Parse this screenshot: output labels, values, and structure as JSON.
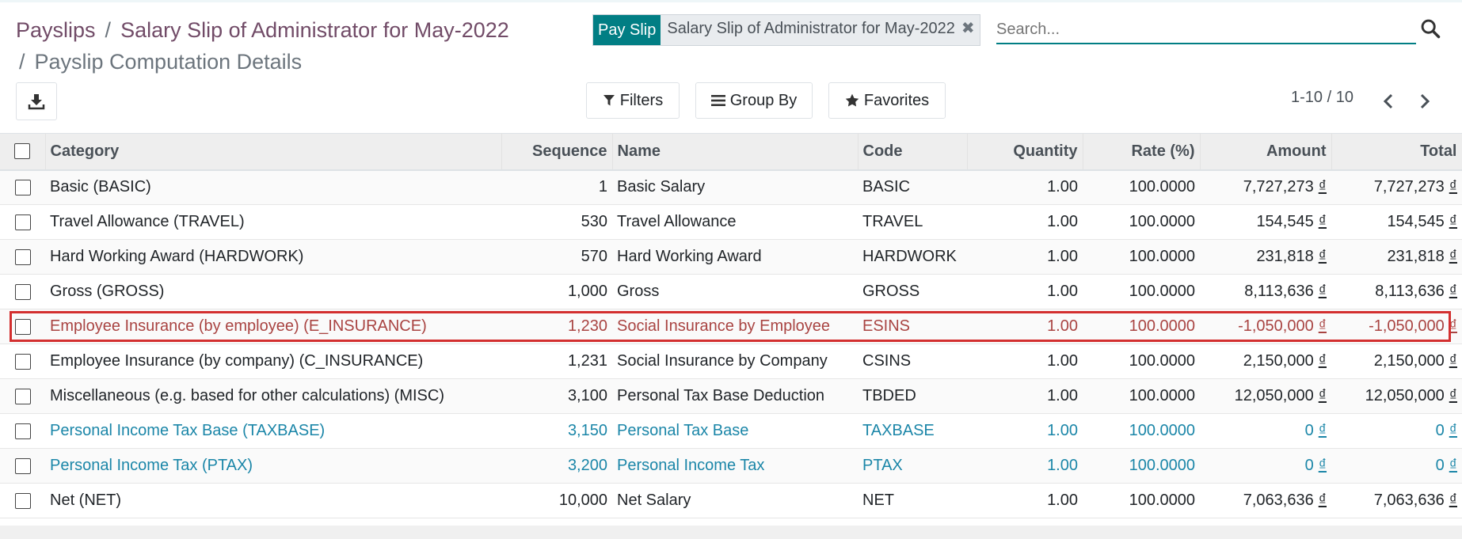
{
  "breadcrumb": {
    "item1": "Payslips",
    "item2": "Salary Slip of Administrator for May-2022",
    "separator": "/",
    "current": "Payslip Computation Details"
  },
  "search": {
    "facet_label": "Pay Slip",
    "facet_value": "Salary Slip of Administrator for May-2022",
    "placeholder": "Search..."
  },
  "controls": {
    "filters": "Filters",
    "group_by": "Group By",
    "favorites": "Favorites",
    "pager": "1-10 / 10"
  },
  "table": {
    "headers": {
      "category": "Category",
      "sequence": "Sequence",
      "name": "Name",
      "code": "Code",
      "quantity": "Quantity",
      "rate": "Rate (%)",
      "amount": "Amount",
      "total": "Total"
    },
    "currency_symbol": "₫",
    "rows": [
      {
        "category": "Basic (BASIC)",
        "sequence": "1",
        "name": "Basic Salary",
        "code": "BASIC",
        "quantity": "1.00",
        "rate": "100.0000",
        "amount": "7,727,273",
        "total": "7,727,273",
        "style": "normal"
      },
      {
        "category": "Travel Allowance (TRAVEL)",
        "sequence": "530",
        "name": "Travel Allowance",
        "code": "TRAVEL",
        "quantity": "1.00",
        "rate": "100.0000",
        "amount": "154,545",
        "total": "154,545",
        "style": "normal"
      },
      {
        "category": "Hard Working Award (HARDWORK)",
        "sequence": "570",
        "name": "Hard Working Award",
        "code": "HARDWORK",
        "quantity": "1.00",
        "rate": "100.0000",
        "amount": "231,818",
        "total": "231,818",
        "style": "normal"
      },
      {
        "category": "Gross (GROSS)",
        "sequence": "1,000",
        "name": "Gross",
        "code": "GROSS",
        "quantity": "1.00",
        "rate": "100.0000",
        "amount": "8,113,636",
        "total": "8,113,636",
        "style": "normal"
      },
      {
        "category": "Employee Insurance (by employee) (E_INSURANCE)",
        "sequence": "1,230",
        "name": "Social Insurance by Employee",
        "code": "ESINS",
        "quantity": "1.00",
        "rate": "100.0000",
        "amount": "-1,050,000",
        "total": "-1,050,000",
        "style": "danger"
      },
      {
        "category": "Employee Insurance (by company) (C_INSURANCE)",
        "sequence": "1,231",
        "name": "Social Insurance by Company",
        "code": "CSINS",
        "quantity": "1.00",
        "rate": "100.0000",
        "amount": "2,150,000",
        "total": "2,150,000",
        "style": "normal"
      },
      {
        "category": "Miscellaneous (e.g. based for other calculations) (MISC)",
        "sequence": "3,100",
        "name": "Personal Tax Base Deduction",
        "code": "TBDED",
        "quantity": "1.00",
        "rate": "100.0000",
        "amount": "12,050,000",
        "total": "12,050,000",
        "style": "normal"
      },
      {
        "category": "Personal Income Tax Base (TAXBASE)",
        "sequence": "3,150",
        "name": "Personal Tax Base",
        "code": "TAXBASE",
        "quantity": "1.00",
        "rate": "100.0000",
        "amount": "0",
        "total": "0",
        "style": "info"
      },
      {
        "category": "Personal Income Tax (PTAX)",
        "sequence": "3,200",
        "name": "Personal Income Tax",
        "code": "PTAX",
        "quantity": "1.00",
        "rate": "100.0000",
        "amount": "0",
        "total": "0",
        "style": "info"
      },
      {
        "category": "Net (NET)",
        "sequence": "10,000",
        "name": "Net Salary",
        "code": "NET",
        "quantity": "1.00",
        "rate": "100.0000",
        "amount": "7,063,636",
        "total": "7,063,636",
        "style": "normal"
      }
    ]
  }
}
